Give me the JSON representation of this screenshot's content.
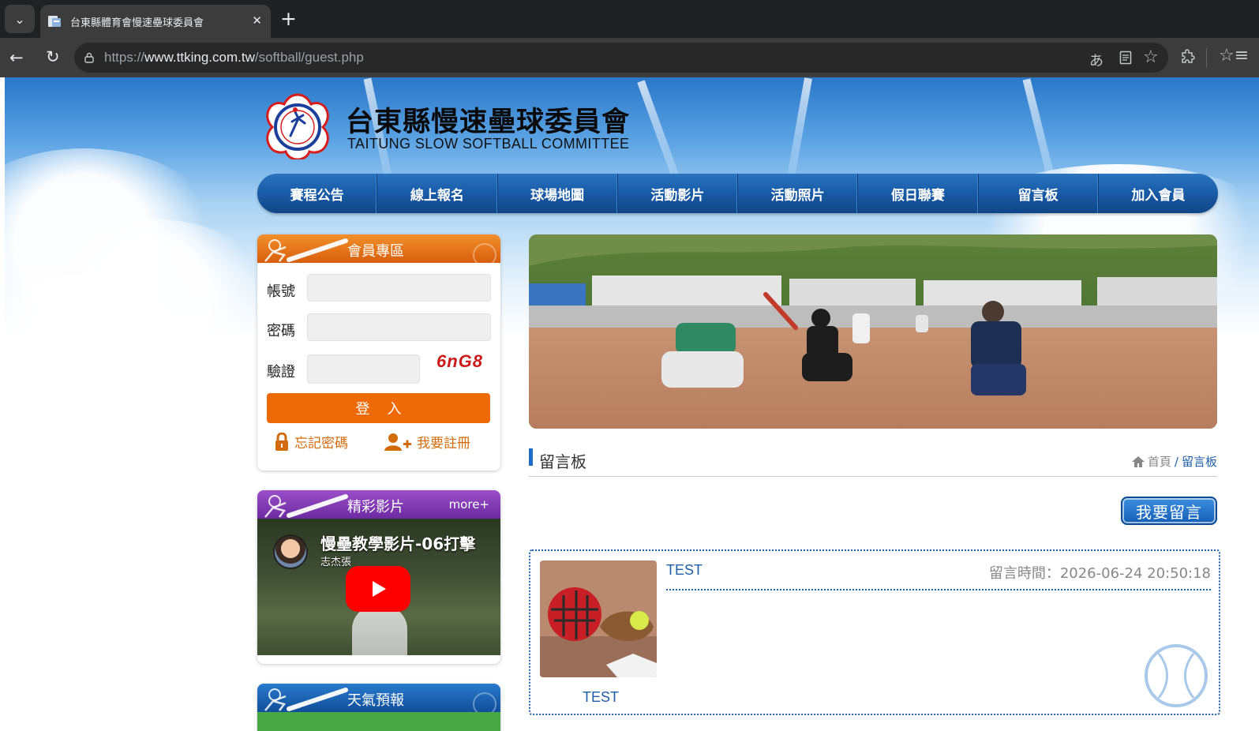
{
  "browser": {
    "tab_title": "台東縣體育會慢速壘球委員會",
    "url_scheme": "https://",
    "url_host": "www.ttking.com.tw",
    "url_path": "/softball/guest.php",
    "icons": [
      "tab-list-icon",
      "favicon-icon",
      "close-icon",
      "new-tab-icon",
      "back-icon",
      "reload-icon",
      "site-info-icon",
      "translate-icon",
      "reading-mode-icon",
      "bookmark-star-icon",
      "extensions-icon",
      "favorites-icon"
    ]
  },
  "site": {
    "name_zh": "台東縣慢速壘球委員會",
    "name_en": "TAITUNG SLOW SOFTBALL COMMITTEE"
  },
  "nav": [
    "賽程公告",
    "線上報名",
    "球場地圖",
    "活動影片",
    "活動照片",
    "假日聯賽",
    "留言板",
    "加入會員"
  ],
  "member_panel": {
    "title": "會員專區",
    "account_label": "帳號",
    "password_label": "密碼",
    "captcha_label": "驗證",
    "captcha_text": "6nG8",
    "account_value": "",
    "password_value": "",
    "captcha_value": "",
    "login_button": "登入",
    "forgot_link": "忘記密碼",
    "register_link": "我要註冊"
  },
  "video_panel": {
    "title": "精彩影片",
    "more": "more+",
    "video_title": "慢壘教學影片-06打擊",
    "channel": "志杰張"
  },
  "weather_panel": {
    "title": "天氣預報"
  },
  "board": {
    "title": "留言板",
    "breadcrumb_home": "首頁",
    "breadcrumb_sep": "/",
    "breadcrumb_current": "留言板",
    "post_button": "我要留言",
    "messages": [
      {
        "author": "TEST",
        "subject": "TEST",
        "time_label": "留言時間：",
        "time": "2026-06-24 20:50:18"
      }
    ]
  },
  "colors": {
    "nav_blue": "#1a5da9",
    "orange": "#ee6a06",
    "purple": "#7b33ad",
    "link_blue": "#1f5fa8",
    "captcha_red": "#cc1a1a"
  }
}
